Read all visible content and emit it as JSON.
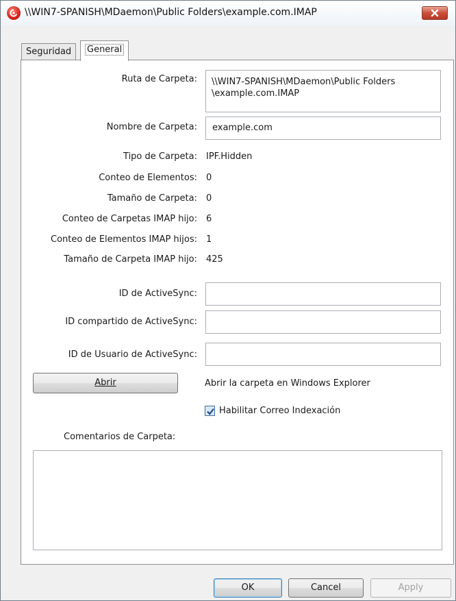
{
  "window": {
    "title": "\\\\WIN7-SPANISH\\MDaemon\\Public Folders\\example.com.IMAP"
  },
  "tabs": [
    {
      "label": "Seguridad",
      "selected": false
    },
    {
      "label": "General",
      "selected": true
    }
  ],
  "general": {
    "ruta_label": "Ruta de Carpeta:",
    "ruta_line1": "\\\\WIN7-SPANISH\\MDaemon\\Public Folders",
    "ruta_line2": "\\example.com.IMAP",
    "nombre_label": "Nombre de Carpeta:",
    "nombre_value": "example.com",
    "tipo_label": "Tipo de Carpeta:",
    "tipo_value": "IPF.Hidden",
    "conteo_label": "Conteo de Elementos:",
    "conteo_value": "0",
    "tamano_label": "Tamaño de Carpeta:",
    "tamano_value": "0",
    "conteo_carpetas_imap_label": "Conteo de Carpetas IMAP hijo:",
    "conteo_carpetas_imap_value": "6",
    "conteo_elementos_imap_label": "Conteo de Elementos IMAP hijos:",
    "conteo_elementos_imap_value": "1",
    "tamano_imap_label": "Tamaño de Carpeta IMAP hijo:",
    "tamano_imap_value": "425",
    "activesync_id_label": "ID de ActiveSync:",
    "activesync_id_value": "",
    "activesync_shared_label": "ID compartido de ActiveSync:",
    "activesync_shared_value": "",
    "activesync_user_label": "ID de Usuario de ActiveSync:",
    "activesync_user_value": "",
    "abrir_button": "Abrir",
    "abrir_description": "Abrir la carpeta en Windows Explorer",
    "indexacion_checkbox_label": "Habilitar Correo Indexación",
    "indexacion_checked": true,
    "comentarios_label": "Comentarios de Carpeta:",
    "comentarios_value": ""
  },
  "footer": {
    "ok": "OK",
    "cancel": "Cancel",
    "apply": "Apply"
  },
  "colors": {
    "close_button": "#c9503c",
    "app_icon": "#d4221a",
    "checkbox_check": "#1e4f8c"
  },
  "icons": [
    "app-icon",
    "close-icon",
    "checkmark-icon",
    "scroll-up-icon",
    "scroll-down-icon"
  ]
}
